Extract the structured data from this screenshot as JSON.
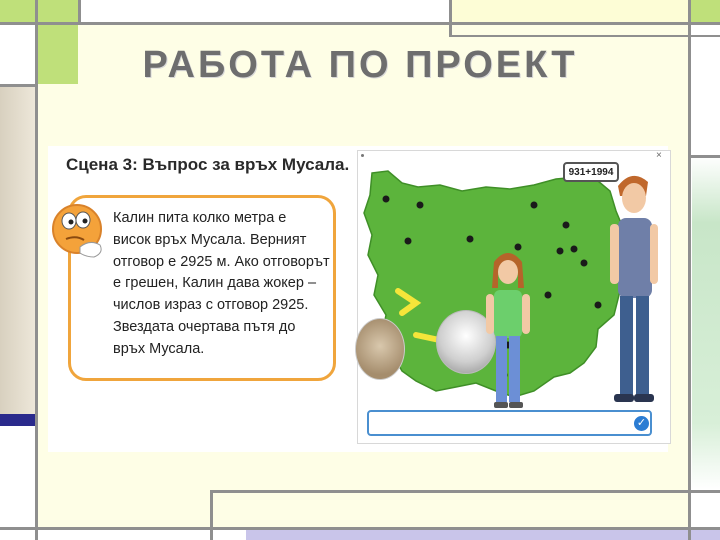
{
  "slide": {
    "title": "РАБОТА ПО ПРОЕКТ"
  },
  "scene": {
    "heading": "Сцена 3: Въпрос за връх Мусала.",
    "paragraph_lines": [
      "Калин пита колко метра е",
      "висок връх Мусала. Верният",
      "отговор е 2925 м. Ако отговорът",
      "е грешен, Калин дава жокер –",
      "числов израз с отговор 2925.",
      "Звездата очертава пътя до",
      "връх Мусала."
    ]
  },
  "game": {
    "badge_text": "931+1994",
    "close_glyph": "×",
    "answer_value": "",
    "check_glyph": "✓",
    "map_color": "#5cb43c",
    "path_color": "#f5e53a",
    "icons": [
      "thinking-face-icon",
      "close-icon",
      "check-icon"
    ]
  },
  "colors": {
    "accent_green": "#bfe07a",
    "frame_gray": "#8f8f8f",
    "slide_bg": "#fefee6",
    "speech_border": "#f0a53c",
    "navy_accent": "#2a2a8c"
  }
}
